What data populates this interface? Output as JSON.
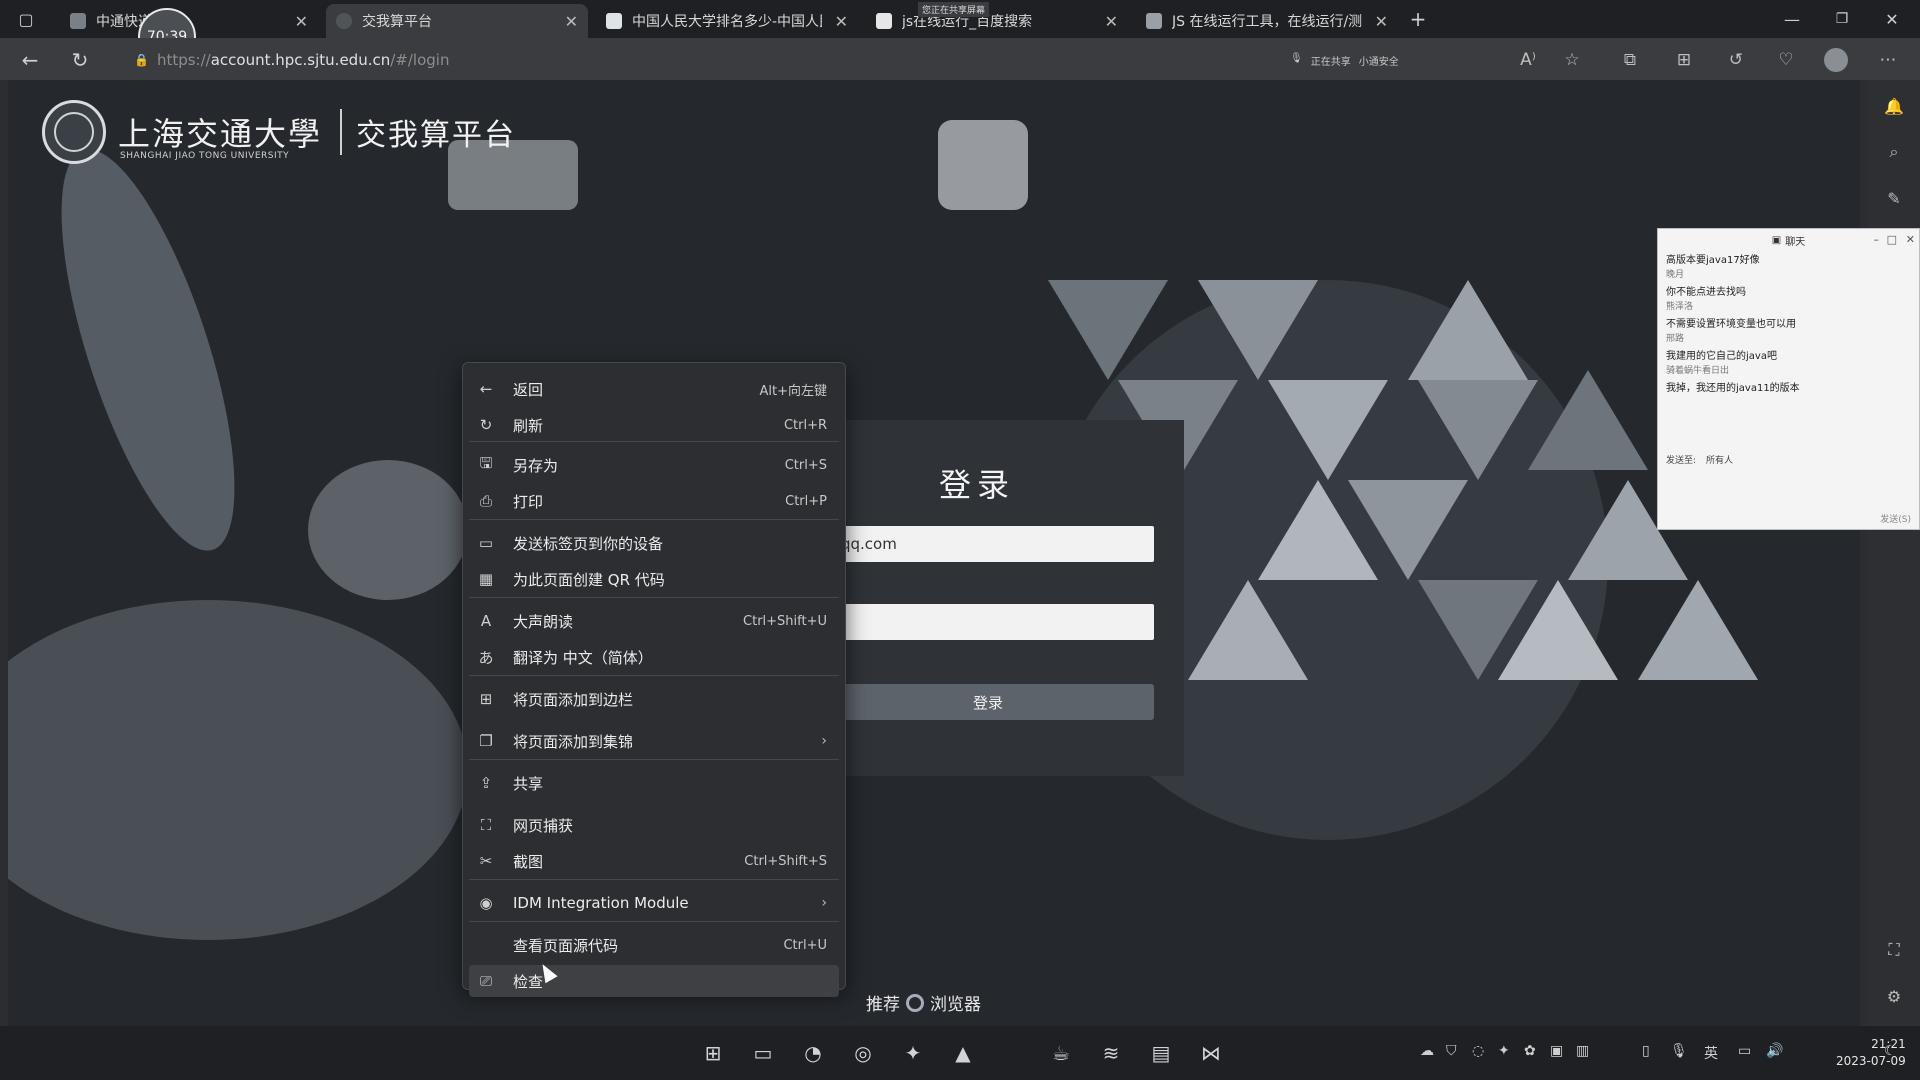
{
  "tabs": [
    {
      "title": "中通快递",
      "active": false
    },
    {
      "title": "交我算平台",
      "active": true
    },
    {
      "title": "中国人民大学排名多少-中国人民",
      "active": false
    },
    {
      "title": "js在线运行_百度搜索",
      "active": false
    },
    {
      "title": "JS 在线运行工具，在线运行/测试",
      "active": false
    }
  ],
  "timer": "70:39",
  "share_note": "您正在共享屏幕",
  "address": {
    "scheme_dim": "https://",
    "host": "account.hpc.sjtu.edu.cn",
    "path_dim": "/#/login"
  },
  "toolbar_status": {
    "sharing": "正在共享",
    "security": "小通安全"
  },
  "logo": {
    "cn": "上海交通大學",
    "en": "SHANGHAI JIAO TONG UNIVERSITY",
    "platform": "交我算平台"
  },
  "login": {
    "title": "登录",
    "email_value": "@qq.com",
    "password_value": "",
    "button": "登录"
  },
  "recommend": {
    "prefix": "推荐",
    "suffix": "浏览器"
  },
  "context_menu": [
    {
      "icon": "back-arrow-icon",
      "glyph": "←",
      "label": "返回",
      "shortcut": "Alt+向左键"
    },
    {
      "icon": "refresh-icon",
      "glyph": "↻",
      "label": "刷新",
      "shortcut": "Ctrl+R"
    },
    {
      "icon": "save-as-icon",
      "glyph": "🖫",
      "label": "另存为",
      "shortcut": "Ctrl+S"
    },
    {
      "icon": "print-icon",
      "glyph": "⎙",
      "label": "打印",
      "shortcut": "Ctrl+P"
    },
    {
      "icon": "send-to-device-icon",
      "glyph": "▭",
      "label": "发送标签页到你的设备",
      "shortcut": ""
    },
    {
      "icon": "qr-code-icon",
      "glyph": "▦",
      "label": "为此页面创建 QR 代码",
      "shortcut": ""
    },
    {
      "icon": "read-aloud-icon",
      "glyph": "A",
      "label": "大声朗读",
      "shortcut": "Ctrl+Shift+U"
    },
    {
      "icon": "translate-icon",
      "glyph": "あ",
      "label": "翻译为 中文（简体）",
      "shortcut": ""
    },
    {
      "icon": "add-sidebar-icon",
      "glyph": "⊞",
      "label": "将页面添加到边栏",
      "shortcut": ""
    },
    {
      "icon": "collections-icon",
      "glyph": "❐",
      "label": "将页面添加到集锦",
      "shortcut": "",
      "submenu": true
    },
    {
      "icon": "share-icon",
      "glyph": "⇪",
      "label": "共享",
      "shortcut": ""
    },
    {
      "icon": "web-capture-icon",
      "glyph": "⛶",
      "label": "网页捕获",
      "shortcut": ""
    },
    {
      "icon": "screenshot-icon",
      "glyph": "✂",
      "label": "截图",
      "shortcut": "Ctrl+Shift+S"
    },
    {
      "icon": "idm-icon",
      "glyph": "◉",
      "label": "IDM Integration Module",
      "shortcut": "",
      "submenu": true
    },
    {
      "icon": "",
      "glyph": "",
      "label": "查看页面源代码",
      "shortcut": "Ctrl+U"
    },
    {
      "icon": "inspect-icon",
      "glyph": "⎚",
      "label": "检查",
      "shortcut": ""
    }
  ],
  "chat": {
    "title": "聊天",
    "lines": [
      {
        "text": "高版本要java17好像",
        "name": false
      },
      {
        "text": "晚月",
        "name": true
      },
      {
        "text": "你不能点进去找吗",
        "name": false
      },
      {
        "text": "熊泽洛",
        "name": true
      },
      {
        "text": "不需要设置环境变量也可以用",
        "name": false
      },
      {
        "text": "邢路",
        "name": true
      },
      {
        "text": "我建用的它自己的java吧",
        "name": false
      },
      {
        "text": "骑着蜗牛看日出",
        "name": true
      },
      {
        "text": "我掉，我还用的java11的版本",
        "name": false
      }
    ],
    "send_to_label": "发送至:",
    "send_to_value": "所有人",
    "send_button": "发送(S)"
  },
  "clock": {
    "time": "21:21",
    "date": "2023-07-09"
  },
  "ime": "英"
}
